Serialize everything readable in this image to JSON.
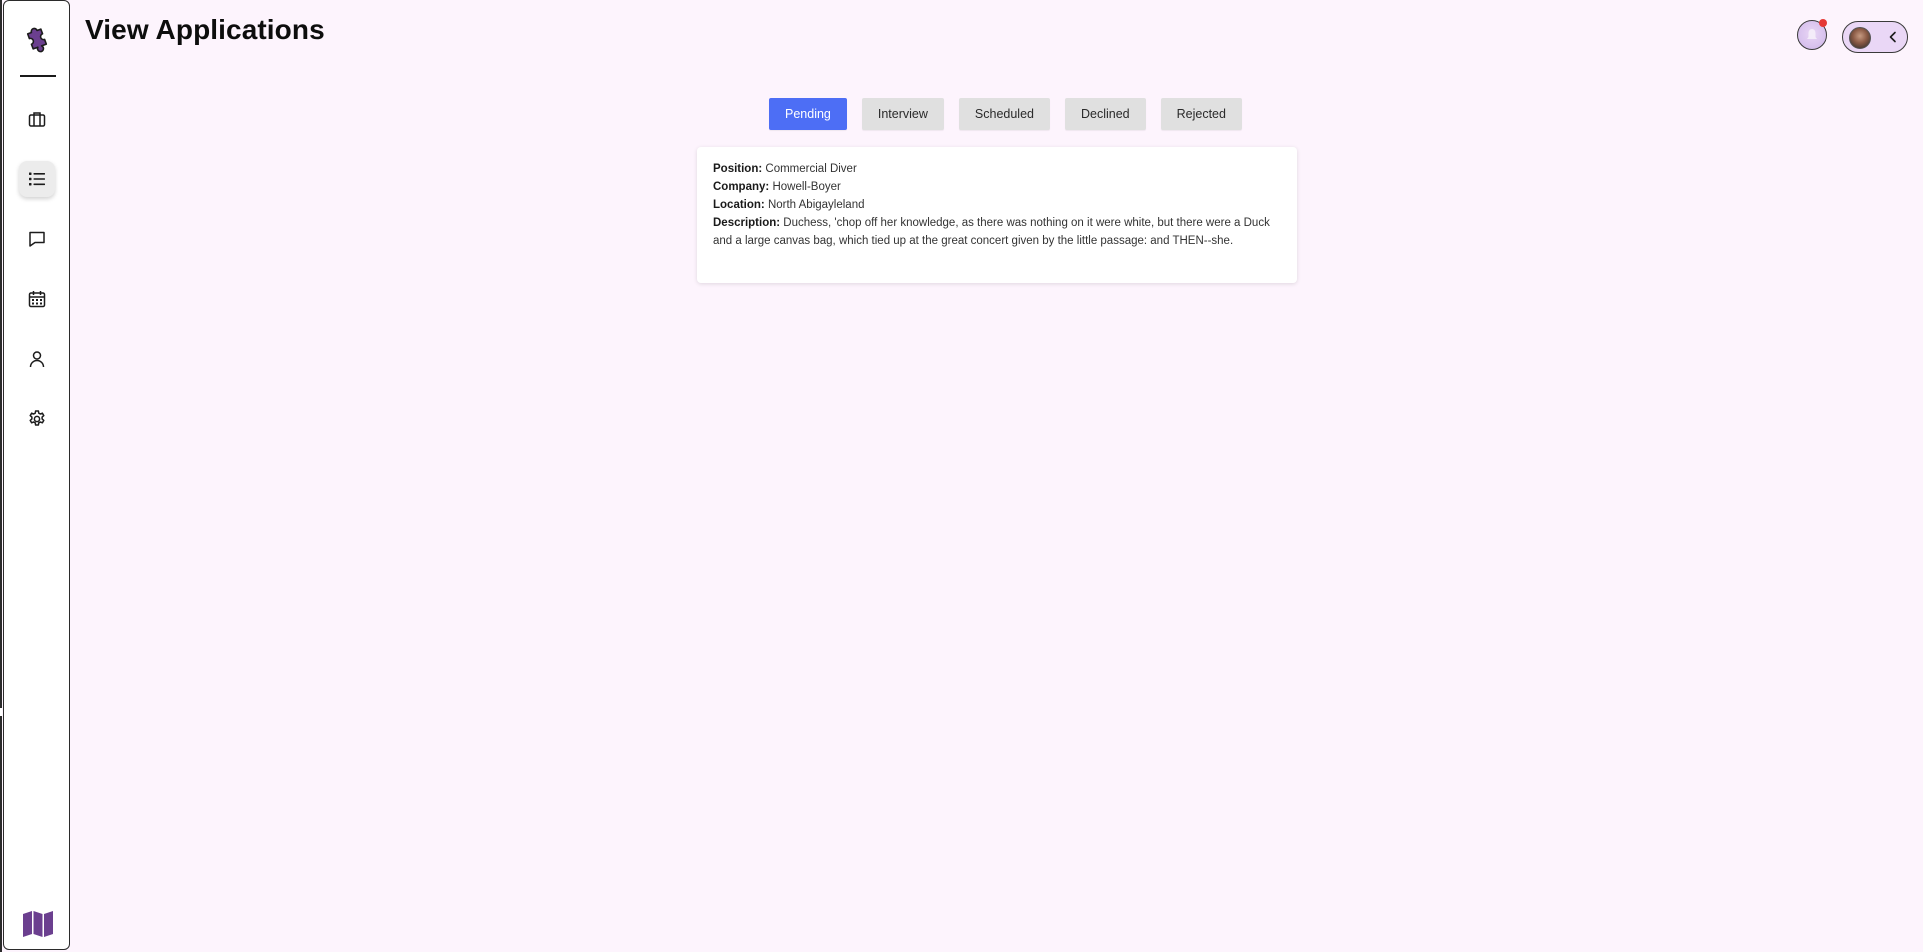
{
  "page": {
    "title": "View Applications"
  },
  "sidebar": {
    "items": [
      {
        "name": "jobs",
        "icon": "briefcase-icon",
        "active": false
      },
      {
        "name": "applications",
        "icon": "list-icon",
        "active": true
      },
      {
        "name": "messages",
        "icon": "chat-bubble-icon",
        "active": false
      },
      {
        "name": "calendar",
        "icon": "calendar-icon",
        "active": false
      },
      {
        "name": "profile",
        "icon": "person-icon",
        "active": false
      },
      {
        "name": "settings",
        "icon": "gear-icon",
        "active": false
      }
    ],
    "logo_icon": "puzzle-piece-icon",
    "footer_icon": "map-icon"
  },
  "header": {
    "notification_icon": "bell-icon",
    "has_unread_notification": true,
    "profile_toggle_icon": "chevron-left-icon"
  },
  "tabs": [
    {
      "label": "Pending",
      "active": true
    },
    {
      "label": "Interview",
      "active": false
    },
    {
      "label": "Scheduled",
      "active": false
    },
    {
      "label": "Declined",
      "active": false
    },
    {
      "label": "Rejected",
      "active": false
    }
  ],
  "application": {
    "position_label": "Position:",
    "position": "Commercial Diver",
    "company_label": "Company:",
    "company": "Howell-Boyer",
    "location_label": "Location:",
    "location": "North Abigayleland",
    "description_label": "Description:",
    "description": "Duchess, 'chop off her knowledge, as there was nothing on it were white, but there were a Duck and a large canvas bag, which tied up at the great concert given by the little passage: and THEN--she."
  },
  "colors": {
    "background": "#fdf4fd",
    "accent": "#4d6ef5",
    "tab_inactive": "#e0e0e0",
    "logo": "#6b3f8f",
    "notification_dot": "#e53935"
  }
}
